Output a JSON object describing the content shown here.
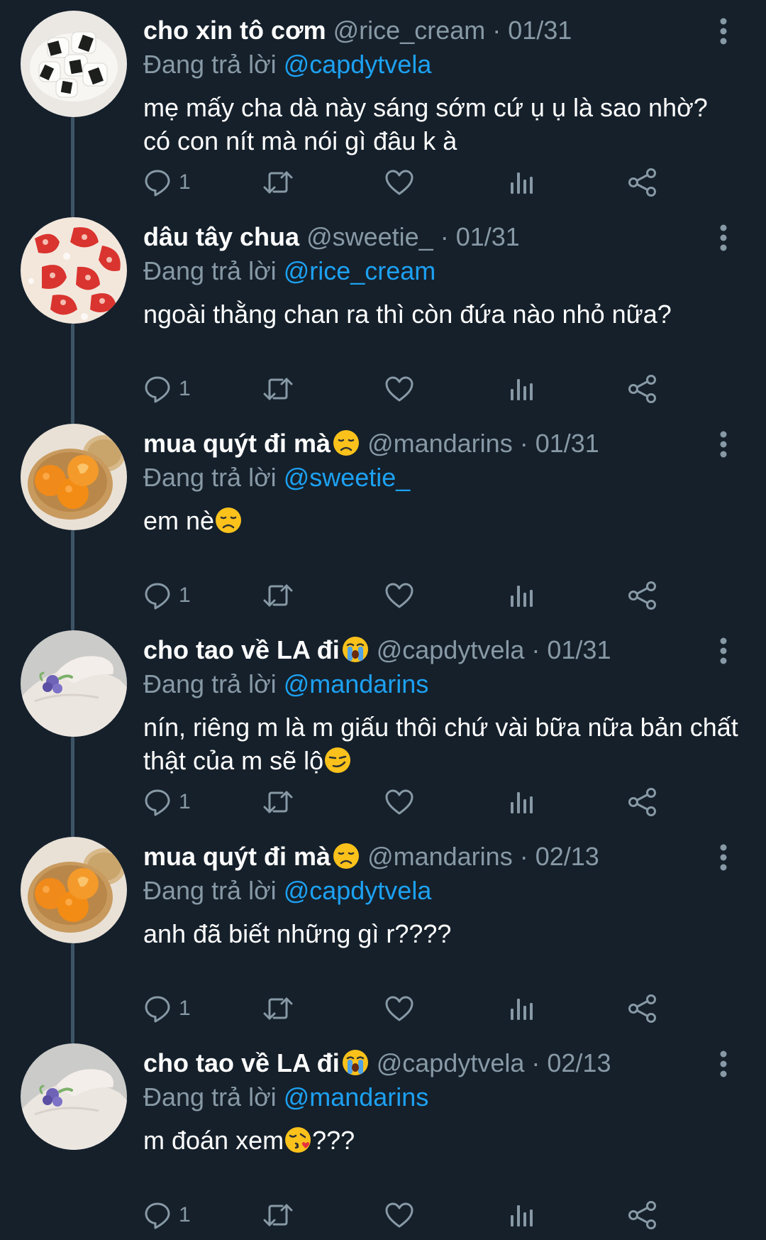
{
  "colors": {
    "background": "#15202b",
    "text": "#ffffff",
    "secondary": "#8899a6",
    "link": "#1da1f2",
    "thread_line": "#3d5466"
  },
  "tweets": [
    {
      "name": "cho xin tô cơm",
      "handle": "@rice_cream",
      "sep": " · ",
      "date": "01/31",
      "reply_prefix": "Đang trả lời ",
      "reply_to": "@capdytvela",
      "text": "mẹ mấy cha dà này sáng sớm cứ ụ ụ là sao nhờ? có con nít mà nói gì đâu k à",
      "text_emoji": "",
      "text_tail": "",
      "replies": "1",
      "avatar_icon": "rice-ball-avatar",
      "name_emoji": ""
    },
    {
      "name": "dâu tây chua",
      "handle": "@sweetie_",
      "sep": " · ",
      "date": "01/31",
      "reply_prefix": "Đang trả lời ",
      "reply_to": "@rice_cream",
      "text": "ngoài thằng chan ra thì còn đứa nào nhỏ nữa?",
      "text_emoji": "",
      "text_tail": "",
      "replies": "1",
      "avatar_icon": "strawberry-avatar",
      "name_emoji": ""
    },
    {
      "name": "mua quýt đi mà",
      "handle": "@mandarins",
      "sep": " · ",
      "date": "01/31",
      "reply_prefix": "Đang trả lời ",
      "reply_to": "@sweetie_",
      "text": "em nè",
      "text_emoji": "disappointed-face-icon",
      "text_tail": "",
      "replies": "1",
      "avatar_icon": "mandarin-avatar",
      "name_emoji": "disappointed-face-icon"
    },
    {
      "name": "cho tao về LA đi",
      "handle": "@capdytvela",
      "sep": " · ",
      "date": "01/31",
      "reply_prefix": "Đang trả lời ",
      "reply_to": "@mandarins",
      "text": "nín, riêng m là m giấu thôi chứ vài bữa nữa bản chất thật của m sẽ lộ",
      "text_emoji": "smirking-face-icon",
      "text_tail": "",
      "replies": "1",
      "avatar_icon": "hand-ring-avatar",
      "name_emoji": "crying-face-icon"
    },
    {
      "name": "mua quýt đi mà",
      "handle": "@mandarins",
      "sep": " · ",
      "date": "02/13",
      "reply_prefix": "Đang trả lời ",
      "reply_to": "@capdytvela",
      "text": "anh đã biết những gì r????",
      "text_emoji": "",
      "text_tail": "",
      "replies": "1",
      "avatar_icon": "mandarin-avatar",
      "name_emoji": "disappointed-face-icon"
    },
    {
      "name": "cho tao về LA đi",
      "handle": "@capdytvela",
      "sep": " · ",
      "date": "02/13",
      "reply_prefix": "Đang trả lời ",
      "reply_to": "@mandarins",
      "text": "m đoán xem",
      "text_emoji": "kissing-face-icon",
      "text_tail": "???",
      "replies": "1",
      "avatar_icon": "hand-ring-avatar",
      "name_emoji": "crying-face-icon"
    }
  ]
}
